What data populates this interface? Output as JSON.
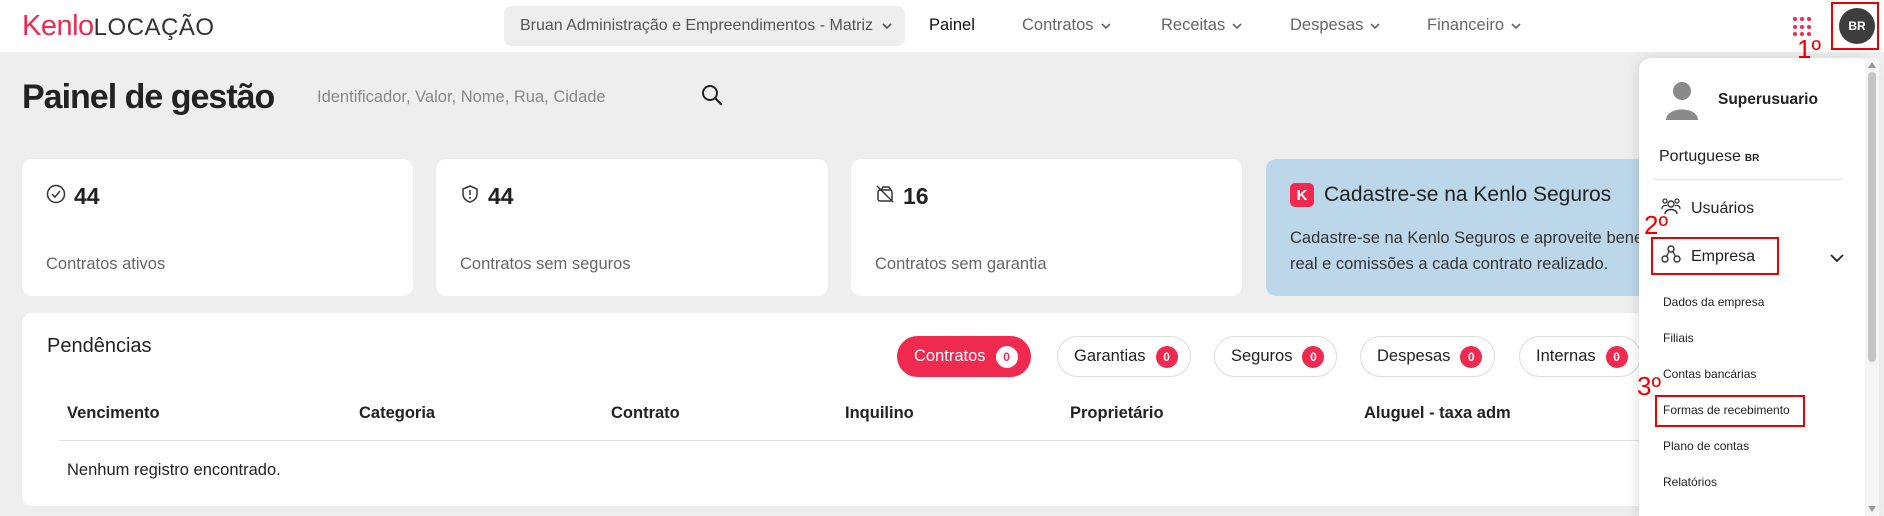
{
  "brand": {
    "name_colored": "Kenlo",
    "name_plain": "LOCAÇÃO",
    "accent": "#f0294f"
  },
  "header": {
    "company": "Bruan Administração e Empreendimentos - Matriz",
    "nav": [
      {
        "label": "Painel",
        "active": true
      },
      {
        "label": "Contratos",
        "has_dropdown": true
      },
      {
        "label": "Receitas",
        "has_dropdown": true
      },
      {
        "label": "Despesas",
        "has_dropdown": true
      },
      {
        "label": "Financeiro",
        "has_dropdown": true
      }
    ],
    "apps_icon": "grid-icon",
    "avatar_initials": "BR"
  },
  "annotations": {
    "step1": "1º",
    "step2": "2º",
    "step3": "3º",
    "color": "#e00000"
  },
  "page": {
    "title": "Painel de gestão",
    "search_placeholder": "Identificador, Valor, Nome, Rua, Cidade"
  },
  "cards": [
    {
      "icon": "check-circle-icon",
      "value": "44",
      "label": "Contratos ativos"
    },
    {
      "icon": "shield-alert-icon",
      "value": "44",
      "label": "Contratos sem seguros"
    },
    {
      "icon": "wallet-off-icon",
      "value": "16",
      "label": "Contratos sem garantia"
    }
  ],
  "promo": {
    "title": "Cadastre-se na Kenlo Seguros",
    "text": "Cadastre-se na Kenlo Seguros e aproveite benefícios de cotação em tempo real e comissões a cada contrato realizado."
  },
  "pendencias": {
    "title": "Pendências",
    "filters": [
      {
        "label": "Contratos",
        "count": "0",
        "active": true
      },
      {
        "label": "Garantias",
        "count": "0"
      },
      {
        "label": "Seguros",
        "count": "0"
      },
      {
        "label": "Despesas",
        "count": "0"
      },
      {
        "label": "Internas",
        "count": "0"
      }
    ],
    "columns": [
      "Vencimento",
      "Categoria",
      "Contrato",
      "Inquilino",
      "Proprietário",
      "Aluguel - taxa adm"
    ],
    "empty_text": "Nenhum registro encontrado."
  },
  "menu": {
    "user_name": "Superusuario",
    "language": "Portuguese",
    "language_code": "BR",
    "items": {
      "usuarios": "Usuários",
      "empresa": "Empresa"
    },
    "empresa_subitems": [
      "Dados da empresa",
      "Filiais",
      "Contas bancárias",
      "Formas de recebimento",
      "Plano de contas",
      "Relatórios"
    ]
  }
}
